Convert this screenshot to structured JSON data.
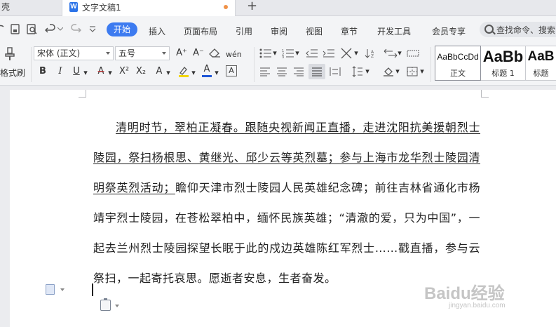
{
  "tabs": {
    "prev_label": "壳",
    "active_label": "文字文稿1",
    "doc_icon_letter": "W",
    "add_symbol": "+"
  },
  "quick_access": {
    "print_icon": "print-icon",
    "preview_icon": "print-preview-icon",
    "undo_icon": "undo-icon",
    "redo_icon": "redo-icon",
    "more_icon": "chevron-down-icon"
  },
  "menu": {
    "items": [
      "开始",
      "插入",
      "页面布局",
      "引用",
      "审阅",
      "视图",
      "章节",
      "开发工具",
      "会员专享"
    ],
    "search_placeholder": "查找命令、搜索"
  },
  "ribbon": {
    "format_painter_label": "格式刷",
    "font_name": "宋体 (正文)",
    "font_size": "五号",
    "bold": "B",
    "italic": "I",
    "underline": "U",
    "strike": "A",
    "superscript": "X²",
    "subscript": "X₂",
    "text_effect": "A",
    "highlight": "A",
    "font_color": "A",
    "char_border": "A",
    "grow_font": "A⁺",
    "shrink_font": "A⁻",
    "styles": [
      {
        "sample": "AaBbCcDd",
        "name": "正文"
      },
      {
        "sample": "AaBb",
        "name": "标题 1"
      },
      {
        "sample": "AaB",
        "name": "标题"
      }
    ]
  },
  "document": {
    "underlined_text": "清明时节，翠柏正凝春。跟随央视新闻正直播，走进沈阳抗美援朝烈士陵园，祭扫杨根思、黄继光、邱少云等英烈墓；参与上海市龙华烈士陵园清明祭英烈活动；",
    "plain_text": "瞻仰天津市烈士陵园人民英雄纪念碑；前往吉林省通化市杨靖宇烈士陵园，在苍松翠柏中，缅怀民族英雄；“清澈的爱，只为中国”，一起去兰州烈士陵园探望长眠于此的戍边英雄陈红军烈士……戳直播，参与云祭扫，一起寄托哀思。愿逝者安息，生者奋发。"
  },
  "watermark": {
    "text": "Baidu经验",
    "url": "jingyan.baidu.com"
  },
  "colors": {
    "accent": "#3d7bf0",
    "tab_dot": "#f09248",
    "font_color_bar": "#1f56d6",
    "highlight_bar": "#f2d600",
    "strike_color": "#d12c2c"
  }
}
